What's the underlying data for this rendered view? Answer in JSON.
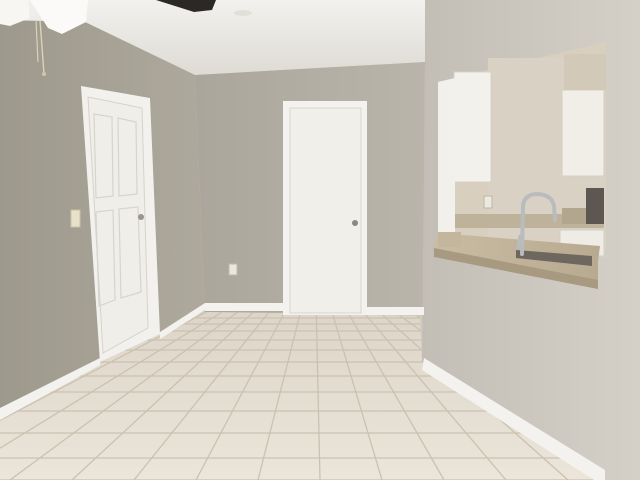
{
  "scene": {
    "description_free": true,
    "colors": {
      "ceiling": "#e9e7e2",
      "wall_left": "#a8a397",
      "wall_back": "#b3afa6",
      "wall_right": "#c9c5bd",
      "trim": "#f3f2ee",
      "door": "#f1f0ec",
      "floor_tile": "#e4ddd1",
      "grout": "#cfc6b7",
      "counter": "#cbbfa8",
      "cabinet": "#f0ede6",
      "kitchen_wall": "#d9d1c3"
    }
  }
}
